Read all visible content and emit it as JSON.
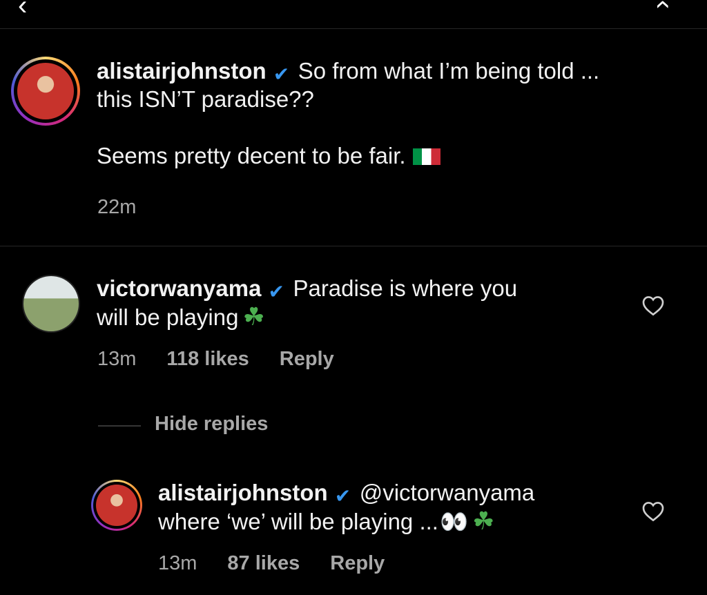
{
  "topbar": {
    "back_icon": "chevron-left-icon",
    "right_icon": "chevron-icon"
  },
  "post": {
    "username": "alistairjohnston",
    "line1": "So from what I’m being told ...",
    "line2": "this ISN’T paradise??",
    "line3": "Seems pretty decent to be fair.",
    "flag_emoji": "🇮🇹",
    "time": "22m"
  },
  "comment1": {
    "username": "victorwanyama",
    "line1": "Paradise is where you",
    "line2": "will be playing",
    "emoji": "☘",
    "time": "13m",
    "likes": "118 likes",
    "reply": "Reply",
    "heart_icon": "heart-outline-icon"
  },
  "hide_replies": "Hide replies",
  "reply1": {
    "username": "alistairjohnston",
    "mention": "@victorwanyama",
    "line2": "where ‘we’ will be playing ...",
    "eyes_emoji": "👀",
    "emoji": "☘",
    "time": "13m",
    "likes": "87 likes",
    "reply": "Reply",
    "heart_icon": "heart-outline-icon"
  },
  "colors": {
    "background": "#000000",
    "verified": "#3897f0",
    "muted_text": "#a8a8a8",
    "clover": "#4caf50"
  }
}
